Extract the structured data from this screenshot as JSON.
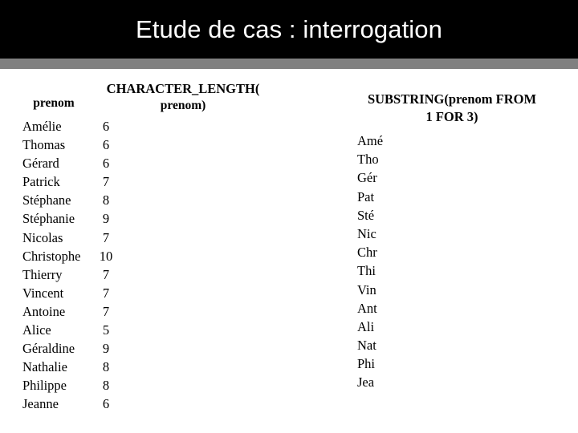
{
  "slide": {
    "title": "Etude de cas : interrogation",
    "title_band_color": "#000000",
    "accent_rule_color": "#808080",
    "background_color": "#ffffff",
    "text_color": "#000000"
  },
  "left_result": {
    "header_prenom": "prenom",
    "header_function_line1": "CHARACTER_LENGTH(",
    "header_function_line2": "prenom)",
    "rows": [
      {
        "prenom": "Amélie",
        "length": "6"
      },
      {
        "prenom": "Thomas",
        "length": "6"
      },
      {
        "prenom": "Gérard",
        "length": "6"
      },
      {
        "prenom": "Patrick",
        "length": "7"
      },
      {
        "prenom": "Stéphane",
        "length": "8"
      },
      {
        "prenom": "Stéphanie",
        "length": "9"
      },
      {
        "prenom": "Nicolas",
        "length": "7"
      },
      {
        "prenom": "Christophe",
        "length": "10"
      },
      {
        "prenom": "Thierry",
        "length": "7"
      },
      {
        "prenom": "Vincent",
        "length": "7"
      },
      {
        "prenom": "Antoine",
        "length": "7"
      },
      {
        "prenom": "Alice",
        "length": "5"
      },
      {
        "prenom": "Géraldine",
        "length": "9"
      },
      {
        "prenom": "Nathalie",
        "length": "8"
      },
      {
        "prenom": "Philippe",
        "length": "8"
      },
      {
        "prenom": "Jeanne",
        "length": "6"
      }
    ]
  },
  "right_result": {
    "header_line1": "SUBSTRING(prenom FROM",
    "header_line2": "1 FOR 3)",
    "rows": [
      {
        "value": "Amé"
      },
      {
        "value": "Tho"
      },
      {
        "value": "Gér"
      },
      {
        "value": "Pat"
      },
      {
        "value": "Sté"
      },
      {
        "value": "Nic"
      },
      {
        "value": "Chr"
      },
      {
        "value": "Thi"
      },
      {
        "value": "Vin"
      },
      {
        "value": "Ant"
      },
      {
        "value": "Ali"
      },
      {
        "value": "Nat"
      },
      {
        "value": "Phi"
      },
      {
        "value": "Jea"
      }
    ]
  }
}
